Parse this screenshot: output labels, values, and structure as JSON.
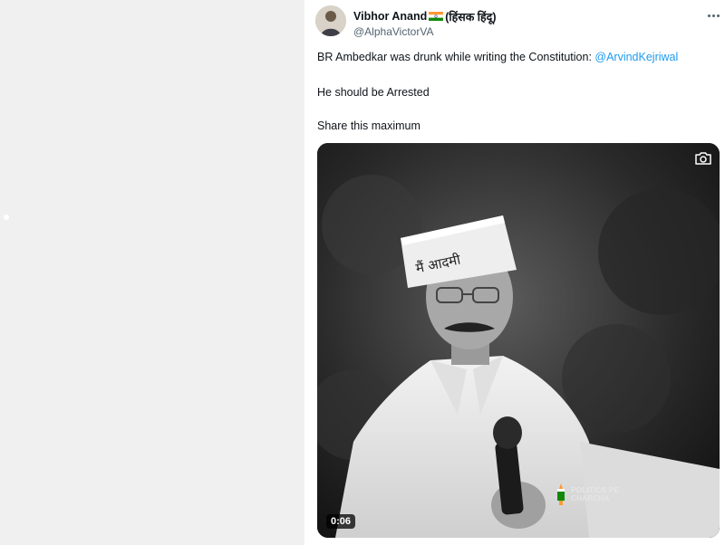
{
  "author": {
    "name": "Vibhor Anand",
    "name_suffix": "(हिंसक हिंदू)",
    "handle": "@AlphaVictorVA"
  },
  "tweet": {
    "line1_text": "BR Ambedkar was drunk while writing the Constitution: ",
    "line1_mention": "@ArvindKejriwal",
    "line2": "He should be Arrested",
    "line3": "Share this maximum"
  },
  "media": {
    "cap_text": "मैं आदमी",
    "duration": "0:06",
    "watermark_line1": "POLITICS PE",
    "watermark_line2": "CHARCHA"
  },
  "icons": {
    "more": "more-horizontal-icon",
    "camera": "camera-icon",
    "flag": "india-flag-icon"
  },
  "colors": {
    "link": "#1d9bf0",
    "secondary_text": "#536471",
    "left_pane": "#f0f0f0"
  }
}
